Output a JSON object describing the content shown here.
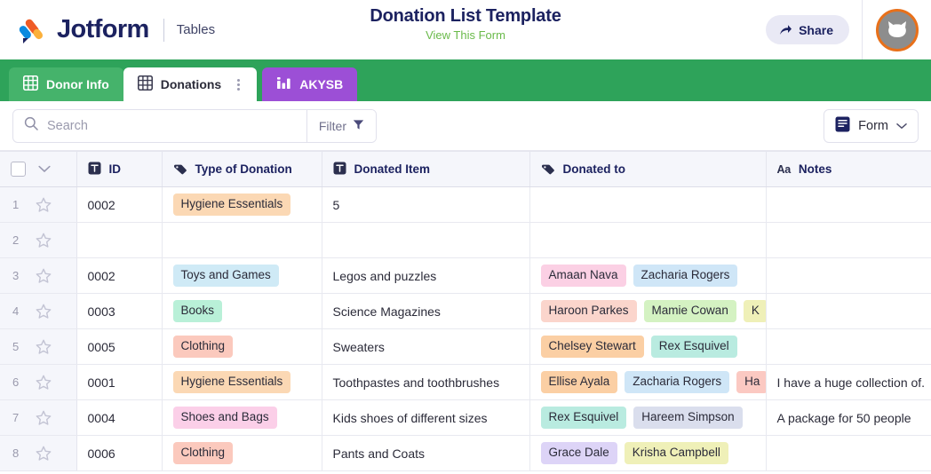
{
  "header": {
    "brand_name": "Jotform",
    "brand_sub": "Tables",
    "doc_title": "Donation List Template",
    "doc_subtitle": "View This Form",
    "share_label": "Share",
    "logo_icon": "jotform-logo-icon",
    "share_icon": "share-arrow-icon",
    "avatar_icon": "cat-avatar-icon",
    "colors": {
      "brand_navy": "#1c2260",
      "green_accent": "#6aba4a",
      "share_bg": "#e9e9f5",
      "avatar_ring": "#e8701a",
      "avatar_fill": "#8d8d8d"
    }
  },
  "tabs": {
    "bar_color": "#2ea35a",
    "items": [
      {
        "label": "Donor Info",
        "icon": "grid-table-icon",
        "state": "inactive-green",
        "color": "#45b36b"
      },
      {
        "label": "Donations",
        "icon": "grid-table-icon",
        "state": "active",
        "color": "#ffffff",
        "menu_icon": "kebab-menu-icon"
      },
      {
        "label": "AKYSB",
        "icon": "bar-chart-icon",
        "state": "report",
        "color": "#9c4fd6"
      }
    ]
  },
  "toolbar": {
    "search_placeholder": "Search",
    "search_value": "",
    "search_icon": "search-icon",
    "filter_label": "Filter",
    "filter_icon": "funnel-icon",
    "form_label": "Form",
    "form_icon": "form-document-icon",
    "form_chevron_icon": "chevron-down-icon"
  },
  "table": {
    "select_all_icon": "checkbox-icon",
    "select_chevron_icon": "chevron-down-icon",
    "columns": [
      {
        "label": "ID",
        "icon": "text-field-icon",
        "type_glyph": "T"
      },
      {
        "label": "Type of Donation",
        "icon": "tag-icon",
        "type_glyph": "tag"
      },
      {
        "label": "Donated Item",
        "icon": "text-field-icon",
        "type_glyph": "T"
      },
      {
        "label": "Donated to",
        "icon": "tag-icon",
        "type_glyph": "tag"
      },
      {
        "label": "Notes",
        "icon": "long-text-icon",
        "type_glyph": "Aa"
      }
    ],
    "rows": [
      {
        "num": "1",
        "id": "0002",
        "type": [
          {
            "text": "Hygiene Essentials",
            "color": "#fbd8b4"
          }
        ],
        "item": "5",
        "to": [],
        "notes": ""
      },
      {
        "num": "2",
        "id": "",
        "type": [],
        "item": "",
        "to": [],
        "notes": ""
      },
      {
        "num": "3",
        "id": "0002",
        "type": [
          {
            "text": "Toys and Games",
            "color": "#cfeaf6"
          }
        ],
        "item": "Legos and puzzles",
        "to": [
          {
            "text": "Amaan Nava",
            "color": "#fbd0e4"
          },
          {
            "text": "Zacharia Rogers",
            "color": "#cfe6f7"
          }
        ],
        "notes": ""
      },
      {
        "num": "4",
        "id": "0003",
        "type": [
          {
            "text": "Books",
            "color": "#b9f0d8"
          }
        ],
        "item": "Science Magazines",
        "to": [
          {
            "text": "Haroon Parkes",
            "color": "#fbd5cc"
          },
          {
            "text": "Mamie Cowan",
            "color": "#d4f2c2"
          },
          {
            "text": "K",
            "color": "#eff0b8"
          }
        ],
        "notes": ""
      },
      {
        "num": "5",
        "id": "0005",
        "type": [
          {
            "text": "Clothing",
            "color": "#fbc9bd"
          }
        ],
        "item": "Sweaters",
        "to": [
          {
            "text": "Chelsey Stewart",
            "color": "#fbcfa4"
          },
          {
            "text": "Rex Esquivel",
            "color": "#b9ebe0"
          }
        ],
        "notes": ""
      },
      {
        "num": "6",
        "id": "0001",
        "type": [
          {
            "text": "Hygiene Essentials",
            "color": "#fbd8b4"
          }
        ],
        "item": "Toothpastes and toothbrushes",
        "to": [
          {
            "text": "Ellise Ayala",
            "color": "#fbcfa4"
          },
          {
            "text": "Zacharia Rogers",
            "color": "#cfe6f7"
          },
          {
            "text": "Ha",
            "color": "#fbc9c2"
          }
        ],
        "notes": "I have a huge collection of."
      },
      {
        "num": "7",
        "id": "0004",
        "type": [
          {
            "text": "Shoes and Bags",
            "color": "#fbcfe8"
          }
        ],
        "item": "Kids shoes of different sizes",
        "to": [
          {
            "text": "Rex Esquivel",
            "color": "#b9ebe0"
          },
          {
            "text": "Hareem Simpson",
            "color": "#dadeed"
          }
        ],
        "notes": "A package for 50 people"
      },
      {
        "num": "8",
        "id": "0006",
        "type": [
          {
            "text": "Clothing",
            "color": "#fbc9bd"
          }
        ],
        "item": "Pants and Coats",
        "to": [
          {
            "text": "Grace Dale",
            "color": "#ddd4f7"
          },
          {
            "text": "Krisha Campbell",
            "color": "#eff0b8"
          }
        ],
        "notes": ""
      }
    ]
  }
}
